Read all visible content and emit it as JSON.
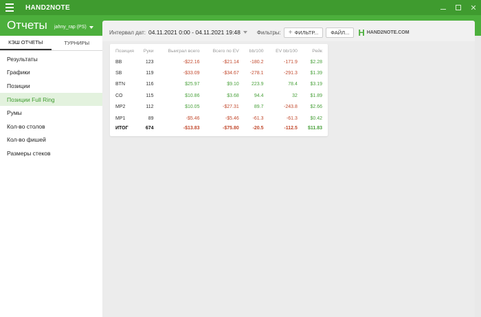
{
  "app": {
    "title": "HAND2NOTE"
  },
  "header": {
    "title": "Отчеты",
    "account": "jahny_rap (PS)"
  },
  "sidebar": {
    "tabs": [
      {
        "label": "КЭШ ОТЧЕТЫ",
        "active": true
      },
      {
        "label": "ТУРНИРЫ",
        "active": false
      }
    ],
    "items": [
      {
        "label": "Результаты"
      },
      {
        "label": "Графики"
      },
      {
        "label": "Позиции"
      },
      {
        "label": "Позиции Full Ring",
        "active": true
      },
      {
        "label": "Румы"
      },
      {
        "label": "Кол-во столов"
      },
      {
        "label": "Кол-во фишей"
      },
      {
        "label": "Размеры стеков"
      }
    ]
  },
  "toolbar": {
    "interval_label": "Интервал дат:",
    "interval_value": "04.11.2021 0:00 - 04.11.2021 19:48",
    "filters_label": "Фильтры:",
    "filter_button": "ФИЛЬТР...",
    "file_button": "ФАЙЛ...",
    "logo_text": "HAND2NOTE.COM"
  },
  "table": {
    "columns": [
      "Позиция",
      "Руки",
      "Выиграл всего",
      "Всего по EV",
      "bb/100",
      "EV bb/100",
      "Рейк"
    ],
    "rows": [
      [
        "BB",
        "123",
        "-$22.16",
        "-$21.14",
        "-180.2",
        "-171.9",
        "$2.28"
      ],
      [
        "SB",
        "119",
        "-$33.09",
        "-$34.67",
        "-278.1",
        "-291.3",
        "$1.39"
      ],
      [
        "BTN",
        "116",
        "$25.97",
        "$9.10",
        "223.9",
        "78.4",
        "$3.19"
      ],
      [
        "CO",
        "115",
        "$10.86",
        "$3.68",
        "94.4",
        "32",
        "$1.89"
      ],
      [
        "MP2",
        "112",
        "$10.05",
        "-$27.31",
        "89.7",
        "-243.8",
        "$2.66"
      ],
      [
        "MP1",
        "89",
        "-$5.46",
        "-$5.46",
        "-61.3",
        "-61.3",
        "$0.42"
      ]
    ],
    "total": [
      "ИТОГ",
      "674",
      "-$13.83",
      "-$75.80",
      "-20.5",
      "-112.5",
      "$11.83"
    ]
  },
  "colors": {
    "brand_green": "#4caf3c",
    "positive": "#4aa13c",
    "negative": "#c24a2e"
  }
}
